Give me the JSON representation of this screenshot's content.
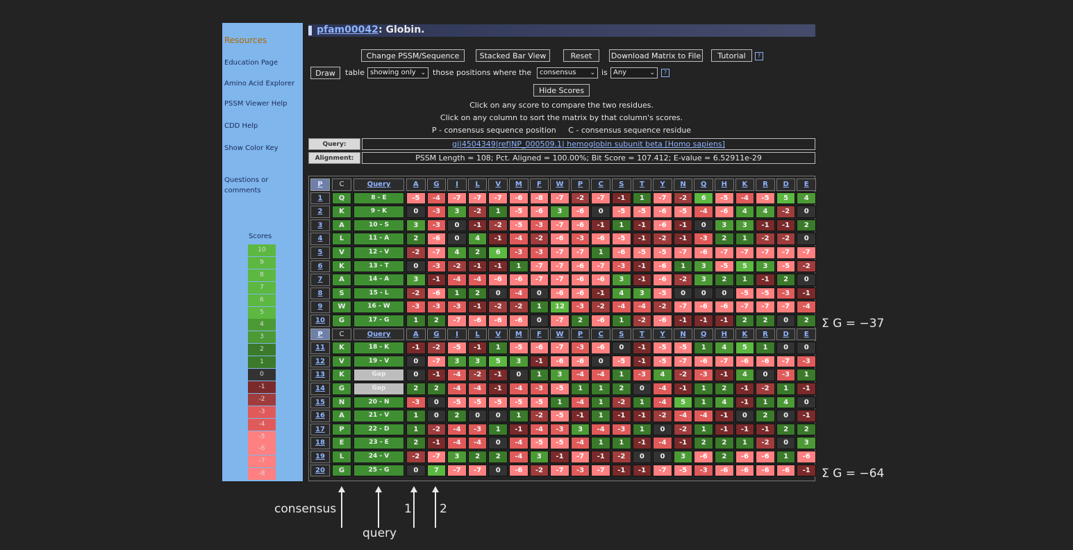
{
  "sidebar": {
    "title": "Resources",
    "links": [
      "Education Page",
      "Amino Acid Explorer",
      "PSSM Viewer Help",
      "CDD Help",
      "Show Color Key"
    ],
    "questions": [
      "Questions or",
      "comments"
    ],
    "scores_title": "Scores",
    "legend": [
      "10",
      "9",
      "8",
      "7",
      "6",
      "5",
      "4",
      "3",
      "2",
      "1",
      "0",
      "-1",
      "-2",
      "-3",
      "-4",
      "-5",
      "-6",
      "-7",
      "-8"
    ]
  },
  "header": {
    "accession": "pfam00042",
    "title_rest": ": Globin."
  },
  "toolbar": {
    "buttons": [
      "Change PSSM/Sequence",
      "Stacked Bar View",
      "Reset",
      "Download Matrix to File",
      "Tutorial"
    ],
    "draw_label": "Draw",
    "table_label": "table",
    "mode_select": "showing only",
    "those_label": "those positions where the",
    "field_select": "consensus",
    "is_label": "is",
    "value_select": "Any",
    "hide_scores": "Hide Scores",
    "help_glyph": "?"
  },
  "info": {
    "line1": "Click on any score to compare the two residues.",
    "line2": "Click on any column to sort the matrix by that column's scores.",
    "line3": "P - consensus sequence position     C - consensus sequence residue"
  },
  "query": {
    "query_label": "Query:",
    "query_value": "gi|4504349|ref|NP_000509.1| hemoglobin subunit beta [Homo sapiens]",
    "alignment_label": "Alignment:",
    "alignment_value": "PSSM Length = 108; Pct. Aligned = 100.00%; Bit Score = 107.412; E-value = 6.52911e-29"
  },
  "matrix": {
    "header": [
      "P",
      "C",
      "Query",
      "A",
      "G",
      "I",
      "L",
      "V",
      "M",
      "F",
      "W",
      "P",
      "C",
      "S",
      "T",
      "Y",
      "N",
      "Q",
      "H",
      "K",
      "R",
      "D",
      "E"
    ],
    "rows": [
      {
        "p": "1",
        "c": "Q",
        "q": "8 - E",
        "s": [
          -5,
          -4,
          -7,
          -7,
          -7,
          -6,
          -8,
          -7,
          -2,
          -7,
          -1,
          1,
          -7,
          -2,
          6,
          -5,
          -4,
          -5,
          5,
          4
        ]
      },
      {
        "p": "2",
        "c": "K",
        "q": "9 - K",
        "s": [
          0,
          -3,
          3,
          -2,
          1,
          -5,
          -6,
          3,
          -6,
          0,
          -5,
          -5,
          -6,
          -5,
          -4,
          -6,
          4,
          4,
          -2,
          0
        ]
      },
      {
        "p": "3",
        "c": "A",
        "q": "10 - S",
        "s": [
          3,
          -3,
          0,
          -1,
          -2,
          -5,
          -3,
          -7,
          -6,
          -1,
          1,
          -1,
          -6,
          -1,
          0,
          3,
          3,
          -1,
          -1,
          2
        ]
      },
      {
        "p": "4",
        "c": "L",
        "q": "11 - A",
        "s": [
          2,
          -6,
          0,
          4,
          -1,
          -4,
          -2,
          -6,
          -3,
          -6,
          -5,
          -1,
          -2,
          -1,
          -3,
          2,
          1,
          -2,
          -2,
          0
        ]
      },
      {
        "p": "5",
        "c": "V",
        "q": "12 - V",
        "s": [
          -2,
          -7,
          4,
          2,
          6,
          -3,
          -3,
          -7,
          -7,
          1,
          -6,
          -5,
          -5,
          -7,
          -6,
          -7,
          -7,
          -7,
          -7,
          -7
        ]
      },
      {
        "p": "6",
        "c": "K",
        "q": "13 - T",
        "s": [
          0,
          -3,
          -2,
          -1,
          -1,
          1,
          -7,
          -7,
          -6,
          -7,
          -3,
          -1,
          -6,
          1,
          3,
          -5,
          5,
          3,
          -5,
          -2
        ]
      },
      {
        "p": "7",
        "c": "A",
        "q": "14 - A",
        "s": [
          3,
          -1,
          -4,
          -4,
          -6,
          -6,
          -7,
          -7,
          -6,
          -6,
          3,
          -1,
          -6,
          -2,
          3,
          2,
          1,
          -1,
          2,
          0
        ]
      },
      {
        "p": "8",
        "c": "S",
        "q": "15 - L",
        "s": [
          -2,
          -6,
          1,
          2,
          0,
          -4,
          0,
          -6,
          -6,
          -1,
          4,
          3,
          -5,
          0,
          0,
          0,
          -5,
          -5,
          -3,
          -1
        ]
      },
      {
        "p": "9",
        "c": "W",
        "q": "16 - W",
        "s": [
          -3,
          -3,
          -3,
          -1,
          -2,
          -2,
          1,
          12,
          -3,
          -2,
          -4,
          -4,
          -2,
          -7,
          -6,
          -6,
          -7,
          -7,
          -7,
          -4
        ]
      },
      {
        "p": "10",
        "c": "G",
        "q": "17 - G",
        "s": [
          1,
          2,
          -7,
          -6,
          -6,
          -6,
          0,
          -7,
          2,
          -6,
          1,
          -2,
          -6,
          -1,
          -1,
          -1,
          2,
          2,
          0,
          2
        ]
      },
      {
        "header": true
      },
      {
        "p": "11",
        "c": "K",
        "q": "18 - K",
        "s": [
          -1,
          -2,
          -5,
          -1,
          1,
          -5,
          -6,
          -7,
          -3,
          -6,
          0,
          -1,
          -5,
          -5,
          1,
          4,
          5,
          1,
          0,
          0
        ]
      },
      {
        "p": "12",
        "c": "V",
        "q": "19 - V",
        "s": [
          0,
          -7,
          3,
          3,
          5,
          3,
          -1,
          -6,
          -6,
          0,
          -5,
          -1,
          -5,
          -7,
          -6,
          -7,
          -6,
          -6,
          -7,
          -3
        ]
      },
      {
        "p": "13",
        "c": "K",
        "q": "Gap",
        "gap": true,
        "s": [
          0,
          -1,
          -4,
          -2,
          -1,
          0,
          1,
          3,
          -4,
          -4,
          1,
          -3,
          4,
          -2,
          -3,
          -1,
          4,
          0,
          -3,
          1
        ]
      },
      {
        "p": "14",
        "c": "G",
        "q": "Gap",
        "gap": true,
        "s": [
          2,
          2,
          -4,
          -4,
          -1,
          -4,
          -3,
          -5,
          1,
          1,
          2,
          0,
          -4,
          -1,
          1,
          2,
          -1,
          -2,
          1,
          -1
        ]
      },
      {
        "p": "15",
        "c": "N",
        "q": "20 - N",
        "s": [
          -3,
          0,
          -5,
          -5,
          -5,
          -5,
          -5,
          1,
          -4,
          1,
          -2,
          1,
          -4,
          5,
          1,
          4,
          -1,
          1,
          4,
          0
        ]
      },
      {
        "p": "16",
        "c": "A",
        "q": "21 - V",
        "s": [
          1,
          0,
          2,
          0,
          0,
          1,
          -2,
          -5,
          -1,
          1,
          -1,
          -1,
          -2,
          -4,
          -4,
          -1,
          0,
          2,
          0,
          -1
        ]
      },
      {
        "p": "17",
        "c": "P",
        "q": "22 - D",
        "s": [
          1,
          -2,
          -4,
          -3,
          1,
          -1,
          -4,
          -3,
          3,
          -4,
          -3,
          1,
          0,
          -2,
          1,
          -1,
          -1,
          -1,
          2,
          2
        ]
      },
      {
        "p": "18",
        "c": "E",
        "q": "23 - E",
        "s": [
          2,
          -1,
          -4,
          -4,
          0,
          -4,
          -5,
          -5,
          -4,
          1,
          1,
          -1,
          -4,
          -1,
          2,
          2,
          1,
          -2,
          0,
          3
        ]
      },
      {
        "p": "19",
        "c": "L",
        "q": "24 - V",
        "s": [
          -2,
          -7,
          3,
          2,
          2,
          -4,
          3,
          -1,
          -7,
          -1,
          -2,
          0,
          0,
          3,
          -6,
          2,
          -6,
          -6,
          1,
          -6
        ]
      },
      {
        "p": "20",
        "c": "G",
        "q": "25 - G",
        "s": [
          0,
          7,
          -7,
          -7,
          0,
          -6,
          -2,
          -7,
          -3,
          -7,
          -1,
          -1,
          -7,
          -5,
          -3,
          -6,
          -6,
          -6,
          -6,
          -1
        ]
      }
    ]
  },
  "annotations": {
    "sum1": "Σ G = −37",
    "sum2": "Σ G = −64",
    "consensus": "consensus",
    "query": "query",
    "one": "1",
    "two": "2"
  },
  "colors": {
    "pos_scale": [
      "#3a7a2a",
      "#4c9a35",
      "#5cb840"
    ],
    "neg_scale": [
      "#7a2a2a",
      "#a03c3c",
      "#e05a5a",
      "#ff8080"
    ],
    "zero": "#333333",
    "self_match": "#c8c8c8"
  }
}
